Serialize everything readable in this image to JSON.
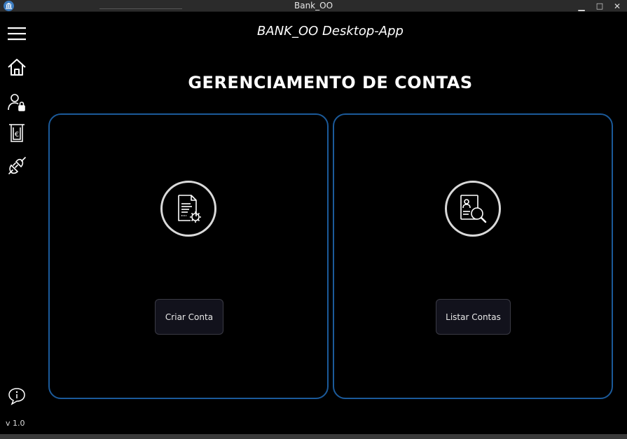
{
  "window": {
    "title": "Bank_OO",
    "minimize": "▁",
    "maximize": "□",
    "close": "✕"
  },
  "sidebar": {
    "items": [
      {
        "name": "menu",
        "icon": "hamburger-menu-icon"
      },
      {
        "name": "home",
        "icon": "home-icon"
      },
      {
        "name": "user-lock",
        "icon": "user-lock-icon"
      },
      {
        "name": "receipt-euro",
        "icon": "euro-receipt-icon"
      },
      {
        "name": "plug",
        "icon": "plug-disconnect-icon"
      }
    ],
    "info_icon": "info-balloon-icon",
    "version": "v 1.0"
  },
  "header": {
    "app_title": "BANK_OO Desktop-App",
    "page_title": "GERENCIAMENTO DE CONTAS"
  },
  "cards": [
    {
      "icon": "document-settings-icon",
      "button_label": "Criar Conta"
    },
    {
      "icon": "profile-search-icon",
      "button_label": "Listar Contas"
    }
  ],
  "colors": {
    "background": "#000000",
    "card_border": "#1b5a9a",
    "button_bg": "#12121c",
    "titlebar": "#2b2b2b"
  }
}
